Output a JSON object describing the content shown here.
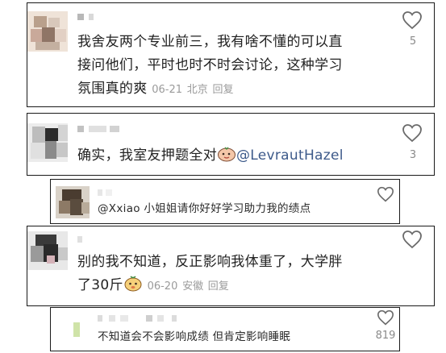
{
  "comments": [
    {
      "text_lines": [
        "我舍友两个专业前三，我有啥不懂的可以直",
        "接问他们，平时也时不时会讨论，这种学习",
        "氛围真的爽"
      ],
      "date": "06-21",
      "location": "北京",
      "reply_label": "回复",
      "like_count": "5"
    },
    {
      "text_prefix": "确实，我室友押题全对",
      "mention": "@LevrautHazel",
      "like_count": "3"
    },
    {
      "text": "@Xxiao 小姐姐请你好好学习助力我的绩点"
    },
    {
      "text_lines": [
        "别的我不知道，反正影响我体重了，大学胖"
      ],
      "line2_text": "了30斤",
      "date": "06-20",
      "location": "安徽",
      "reply_label": "回复"
    },
    {
      "text": "不知道会不会影响成绩 但肯定影响睡眠",
      "like_count": "819"
    }
  ],
  "icons": {
    "like": "heart-outline-icon",
    "sticker": "emoji-sticker-icon"
  }
}
